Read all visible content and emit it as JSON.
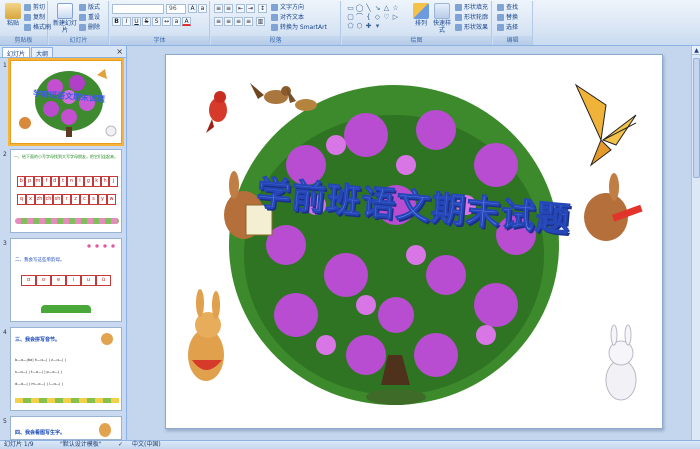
{
  "ribbon": {
    "clipboard": {
      "label": "剪贴板",
      "paste": "粘贴",
      "cut": "剪切",
      "copy": "复制",
      "format_painter": "格式刷"
    },
    "slides": {
      "label": "幻灯片",
      "new_slide": "新建幻灯片",
      "layout": "版式",
      "reset": "重设",
      "delete": "删除"
    },
    "font": {
      "label": "字体",
      "font_name": "",
      "font_size": "96"
    },
    "paragraph": {
      "label": "段落",
      "text_direction": "文字方向",
      "align_text": "对齐文本",
      "convert_smartart": "转换为 SmartArt"
    },
    "drawing": {
      "label": "绘图",
      "arrange": "排列",
      "quick_styles": "快速样式",
      "shape_fill": "形状填充",
      "shape_outline": "形状轮廓",
      "shape_effects": "形状效果"
    },
    "editing": {
      "label": "编辑",
      "find": "查找",
      "replace": "替换",
      "select": "选择"
    }
  },
  "pane": {
    "tabs": [
      "幻灯片",
      "大纲"
    ],
    "thumbs": [
      {
        "num": "1",
        "title": "学前班语文期末试题"
      },
      {
        "num": "2",
        "title": "一、给下面的小写字母找到大写字母朋友，把它们连起来。",
        "row1": [
          "b",
          "p",
          "m",
          "f",
          "d",
          "t",
          "n",
          "l",
          "g",
          "k",
          "h",
          "j"
        ],
        "row2": [
          "q",
          "x",
          "zh",
          "ch",
          "sh",
          "r",
          "z",
          "c",
          "s",
          "y",
          "w"
        ]
      },
      {
        "num": "3",
        "title": "二、我会写这些单韵母。",
        "vowels": [
          "ɑ",
          "o",
          "e",
          "i",
          "u",
          "ü"
        ]
      },
      {
        "num": "4",
        "title": "三、我会拼写音节。",
        "lines": [
          "b—ɑ—(bɑ)  h—ɑ—(   )  z—ɑ—(   )",
          "s—ɑ—(   )  t—ɑ—(   )  p—ɑ—(   )",
          "d—ɑ—(   )  m—ɑ—(   )  l—ɑ—(   )"
        ]
      },
      {
        "num": "5",
        "title": "四、我会看图写生字。"
      }
    ]
  },
  "slide": {
    "title": "学前班语文期末试题"
  },
  "status": {
    "slide_info": "幻灯片 1/9",
    "theme": "\"默认设计模板\"",
    "language": "中文(中国)"
  },
  "colors": {
    "accent": "#f7b33b",
    "title_fill": "#6d8cf5",
    "title_stroke": "#2446b6",
    "frame": "#8db2e3"
  }
}
